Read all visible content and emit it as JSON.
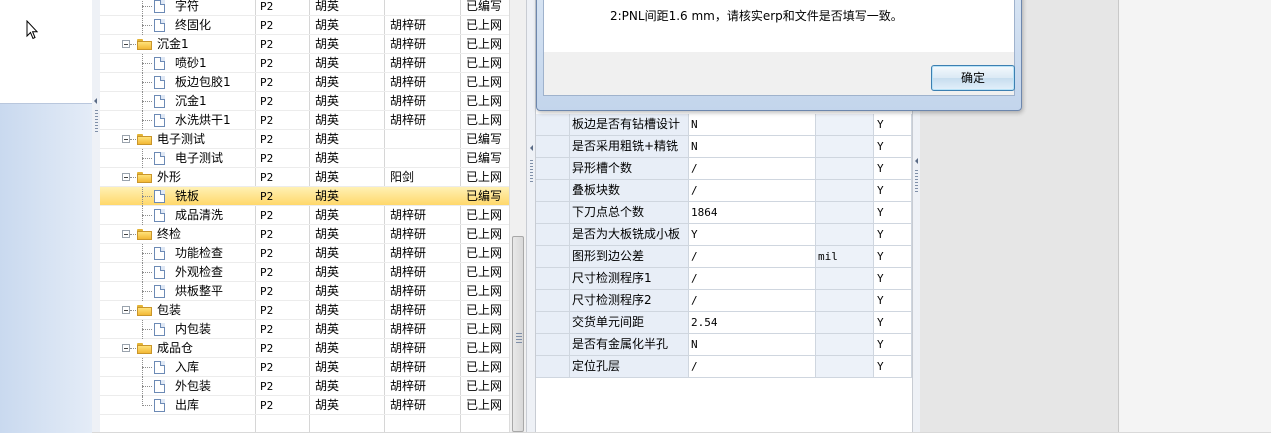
{
  "tree": {
    "rows": [
      {
        "name": "字符",
        "code": "P2",
        "operator": "胡英",
        "reviewer": "",
        "status": "已编写",
        "level": 1,
        "type": "doc"
      },
      {
        "name": "终固化",
        "code": "P2",
        "operator": "胡英",
        "reviewer": "胡梓研",
        "status": "已上网",
        "level": 1,
        "type": "doc"
      },
      {
        "name": "沉金1",
        "code": "P2",
        "operator": "胡英",
        "reviewer": "胡梓研",
        "status": "已上网",
        "level": 0,
        "type": "folder"
      },
      {
        "name": "喷砂1",
        "code": "P2",
        "operator": "胡英",
        "reviewer": "胡梓研",
        "status": "已上网",
        "level": 1,
        "type": "doc"
      },
      {
        "name": "板边包胶1",
        "code": "P2",
        "operator": "胡英",
        "reviewer": "胡梓研",
        "status": "已上网",
        "level": 1,
        "type": "doc"
      },
      {
        "name": "沉金1",
        "code": "P2",
        "operator": "胡英",
        "reviewer": "胡梓研",
        "status": "已上网",
        "level": 1,
        "type": "doc"
      },
      {
        "name": "水洗烘干1",
        "code": "P2",
        "operator": "胡英",
        "reviewer": "胡梓研",
        "status": "已上网",
        "level": 1,
        "type": "doc"
      },
      {
        "name": "电子测试",
        "code": "P2",
        "operator": "胡英",
        "reviewer": "",
        "status": "已编写",
        "level": 0,
        "type": "folder"
      },
      {
        "name": "电子测试",
        "code": "P2",
        "operator": "胡英",
        "reviewer": "",
        "status": "已编写",
        "level": 1,
        "type": "doc"
      },
      {
        "name": "外形",
        "code": "P2",
        "operator": "胡英",
        "reviewer": "阳剑",
        "status": "已上网",
        "level": 0,
        "type": "folder"
      },
      {
        "name": "铣板",
        "code": "P2",
        "operator": "胡英",
        "reviewer": "",
        "status": "已编写",
        "level": 1,
        "type": "doc",
        "selected": true
      },
      {
        "name": "成品清洗",
        "code": "P2",
        "operator": "胡英",
        "reviewer": "胡梓研",
        "status": "已上网",
        "level": 1,
        "type": "doc"
      },
      {
        "name": "终检",
        "code": "P2",
        "operator": "胡英",
        "reviewer": "胡梓研",
        "status": "已上网",
        "level": 0,
        "type": "folder"
      },
      {
        "name": "功能检查",
        "code": "P2",
        "operator": "胡英",
        "reviewer": "胡梓研",
        "status": "已上网",
        "level": 1,
        "type": "doc"
      },
      {
        "name": "外观检查",
        "code": "P2",
        "operator": "胡英",
        "reviewer": "胡梓研",
        "status": "已上网",
        "level": 1,
        "type": "doc"
      },
      {
        "name": "烘板整平",
        "code": "P2",
        "operator": "胡英",
        "reviewer": "胡梓研",
        "status": "已上网",
        "level": 1,
        "type": "doc"
      },
      {
        "name": "包装",
        "code": "P2",
        "operator": "胡英",
        "reviewer": "胡梓研",
        "status": "已上网",
        "level": 0,
        "type": "folder"
      },
      {
        "name": "内包装",
        "code": "P2",
        "operator": "胡英",
        "reviewer": "胡梓研",
        "status": "已上网",
        "level": 1,
        "type": "doc"
      },
      {
        "name": "成品仓",
        "code": "P2",
        "operator": "胡英",
        "reviewer": "胡梓研",
        "status": "已上网",
        "level": 0,
        "type": "folder"
      },
      {
        "name": "入库",
        "code": "P2",
        "operator": "胡英",
        "reviewer": "胡梓研",
        "status": "已上网",
        "level": 1,
        "type": "doc"
      },
      {
        "name": "外包装",
        "code": "P2",
        "operator": "胡英",
        "reviewer": "胡梓研",
        "status": "已上网",
        "level": 1,
        "type": "doc"
      },
      {
        "name": "出库",
        "code": "P2",
        "operator": "胡英",
        "reviewer": "胡梓研",
        "status": "已上网",
        "level": 1,
        "type": "doc"
      }
    ]
  },
  "grid": {
    "rows": [
      {
        "param": "板边是否有钻槽设计",
        "value": "N",
        "unit": "",
        "flag": "Y"
      },
      {
        "param": "是否采用粗铣+精铣",
        "value": "N",
        "unit": "",
        "flag": "Y"
      },
      {
        "param": "异形槽个数",
        "value": "/",
        "unit": "",
        "flag": "Y"
      },
      {
        "param": "叠板块数",
        "value": "/",
        "unit": "",
        "flag": "Y"
      },
      {
        "param": "下刀点总个数",
        "value": "1864",
        "unit": "",
        "flag": "Y"
      },
      {
        "param": "是否为大板铣成小板",
        "value": "Y",
        "unit": "",
        "flag": "Y"
      },
      {
        "param": "图形到边公差",
        "value": "/",
        "unit": "mil",
        "flag": "Y"
      },
      {
        "param": "尺寸检测程序1",
        "value": "/",
        "unit": "",
        "flag": "Y"
      },
      {
        "param": "尺寸检测程序2",
        "value": "/",
        "unit": "",
        "flag": "Y"
      },
      {
        "param": "交货单元间距",
        "value": "2.54",
        "unit": "",
        "flag": "Y"
      },
      {
        "param": "是否有金属化半孔",
        "value": "N",
        "unit": "",
        "flag": "Y"
      },
      {
        "param": "定位孔层",
        "value": "/",
        "unit": "",
        "flag": "Y"
      }
    ]
  },
  "dialog": {
    "message": "2:PNL间距1.6 mm，请核实erp和文件是否填写一致。",
    "ok_label": "确定"
  },
  "colors": {
    "selected_row": "#ffd86b",
    "header_cell": "#e8eef7",
    "dialog_frame": "#c3d5ec"
  }
}
